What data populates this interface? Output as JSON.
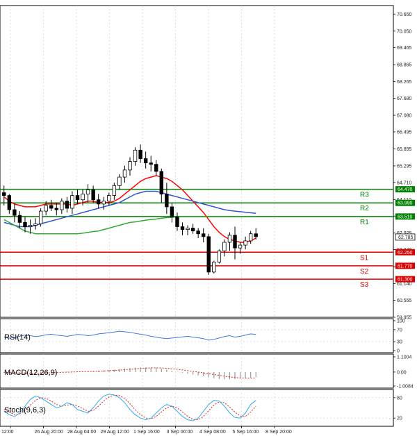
{
  "chart_data": {
    "type": "candlestick",
    "main": {
      "y_ticks": [
        "70.650",
        "70.050",
        "69.465",
        "68.865",
        "68.265",
        "67.680",
        "67.080",
        "66.495",
        "65.895",
        "65.295",
        "64.710",
        "64.110",
        "63.525",
        "62.925",
        "62.340",
        "61.740",
        "61.140",
        "60.555",
        "59.955"
      ],
      "ylim": [
        59.955,
        70.95
      ],
      "last_price": "62.785",
      "last_price_value": 62.785,
      "candles": [
        [
          64.35,
          64.6,
          63.9,
          64.25
        ],
        [
          64.25,
          64.3,
          63.6,
          63.75
        ],
        [
          63.75,
          63.95,
          63.3,
          63.55
        ],
        [
          63.55,
          63.7,
          63.1,
          63.3
        ],
        [
          63.3,
          63.5,
          62.95,
          63.15
        ],
        [
          63.15,
          63.4,
          62.9,
          63.2
        ],
        [
          63.2,
          63.45,
          63.05,
          63.25
        ],
        [
          63.25,
          63.8,
          63.15,
          63.7
        ],
        [
          63.7,
          64.05,
          63.55,
          63.9
        ],
        [
          63.9,
          64.1,
          63.7,
          63.8
        ],
        [
          63.8,
          64.0,
          63.55,
          63.75
        ],
        [
          63.75,
          64.15,
          63.6,
          64.05
        ],
        [
          64.05,
          64.2,
          63.65,
          63.8
        ],
        [
          63.8,
          64.4,
          63.6,
          64.25
        ],
        [
          64.25,
          64.45,
          63.95,
          64.1
        ],
        [
          64.1,
          64.45,
          63.9,
          64.3
        ],
        [
          64.3,
          64.65,
          64.0,
          64.45
        ],
        [
          64.45,
          64.6,
          64.0,
          64.1
        ],
        [
          64.1,
          64.3,
          63.8,
          63.95
        ],
        [
          63.95,
          64.2,
          63.75,
          64.05
        ],
        [
          64.05,
          64.35,
          63.9,
          64.25
        ],
        [
          64.25,
          64.7,
          64.1,
          64.6
        ],
        [
          64.6,
          65.0,
          64.45,
          64.9
        ],
        [
          64.9,
          65.3,
          64.7,
          65.15
        ],
        [
          65.15,
          65.6,
          64.95,
          65.45
        ],
        [
          65.45,
          65.95,
          65.3,
          65.85
        ],
        [
          65.85,
          66.05,
          65.4,
          65.55
        ],
        [
          65.55,
          65.8,
          65.2,
          65.4
        ],
        [
          65.4,
          65.65,
          65.1,
          65.35
        ],
        [
          65.35,
          65.5,
          64.95,
          65.1
        ],
        [
          65.1,
          65.2,
          64.0,
          64.3
        ],
        [
          64.3,
          64.7,
          63.6,
          63.85
        ],
        [
          63.85,
          64.0,
          63.3,
          63.5
        ],
        [
          63.5,
          63.65,
          63.0,
          63.15
        ],
        [
          63.15,
          63.3,
          62.85,
          63.05
        ],
        [
          63.05,
          63.2,
          62.85,
          63.1
        ],
        [
          63.1,
          63.25,
          62.9,
          63.0
        ],
        [
          63.0,
          63.1,
          62.75,
          62.9
        ],
        [
          62.9,
          63.1,
          62.6,
          62.8
        ],
        [
          62.8,
          62.9,
          61.45,
          61.55
        ],
        [
          61.55,
          61.95,
          61.5,
          61.9
        ],
        [
          61.9,
          62.35,
          61.85,
          62.3
        ],
        [
          62.3,
          62.7,
          62.1,
          62.6
        ],
        [
          62.6,
          62.95,
          62.3,
          62.85
        ],
        [
          62.85,
          63.15,
          62.0,
          62.4
        ],
        [
          62.4,
          62.6,
          62.2,
          62.5
        ],
        [
          62.5,
          62.8,
          62.35,
          62.65
        ],
        [
          62.65,
          63.0,
          62.55,
          62.9
        ],
        [
          62.9,
          63.1,
          62.7,
          62.8
        ]
      ],
      "overlays": [
        {
          "name": "ma_fast",
          "color": "#ff0000",
          "values": [
            64.2,
            64.05,
            63.95,
            63.9,
            63.85,
            63.85,
            63.85,
            63.9,
            63.95,
            63.95,
            63.95,
            63.95,
            63.95,
            63.9,
            63.95,
            64.0,
            64.05,
            64.05,
            64.0,
            64.0,
            64.0,
            64.05,
            64.15,
            64.3,
            64.45,
            64.6,
            64.75,
            64.85,
            64.9,
            64.95,
            64.9,
            64.85,
            64.75,
            64.6,
            64.45,
            64.25,
            64.05,
            63.85,
            63.65,
            63.4,
            63.15,
            62.95,
            62.8,
            62.7,
            62.65,
            62.6,
            62.6,
            62.65,
            62.75
          ]
        },
        {
          "name": "ma_mid",
          "color": "#3355cc",
          "values": [
            63.3,
            63.25,
            63.2,
            63.15,
            63.15,
            63.15,
            63.2,
            63.25,
            63.3,
            63.35,
            63.4,
            63.45,
            63.5,
            63.55,
            63.6,
            63.65,
            63.7,
            63.75,
            63.8,
            63.85,
            63.9,
            63.95,
            64.0,
            64.1,
            64.2,
            64.3,
            64.35,
            64.4,
            64.4,
            64.4,
            64.35,
            64.3,
            64.25,
            64.2,
            64.15,
            64.1,
            64.05,
            64.0,
            63.95,
            63.9,
            63.85,
            63.8,
            63.75,
            63.72,
            63.7,
            63.68,
            63.66,
            63.64,
            63.62
          ]
        },
        {
          "name": "ma_slow",
          "color": "#33aa33",
          "values": [
            63.4,
            63.3,
            63.2,
            63.1,
            63.0,
            62.95,
            62.9,
            62.9,
            62.9,
            62.9,
            62.9,
            62.9,
            62.9,
            62.9,
            62.9,
            62.92,
            62.95,
            62.98,
            63.0,
            63.05,
            63.1,
            63.15,
            63.2,
            63.25,
            63.3,
            63.32,
            63.35,
            63.38,
            63.4,
            63.42,
            63.45,
            63.47,
            63.48,
            63.5,
            63.5,
            63.5,
            63.5,
            63.5,
            63.5,
            63.5,
            63.5,
            63.5,
            63.5,
            63.5,
            63.5,
            63.5,
            63.5,
            63.5,
            63.5
          ]
        }
      ],
      "levels": [
        {
          "name": "R3",
          "value": 64.47,
          "tag": "64.470",
          "color": "#008000"
        },
        {
          "name": "R2",
          "value": 63.99,
          "tag": "63.990",
          "color": "#008000"
        },
        {
          "name": "R1",
          "value": 63.51,
          "tag": "63.510",
          "color": "#008000"
        },
        {
          "name": "S1",
          "value": 62.25,
          "tag": "62.250",
          "color": "#dd0000"
        },
        {
          "name": "S2",
          "value": 61.77,
          "tag": "61.770",
          "color": "#dd0000"
        },
        {
          "name": "S3",
          "value": 61.3,
          "tag": "61.300",
          "color": "#dd0000"
        }
      ]
    },
    "rsi": {
      "label": "RSI(14)",
      "y_ticks": [
        "100",
        "70",
        "30",
        "0"
      ],
      "ylim": [
        0,
        100
      ],
      "values": [
        45,
        42,
        44,
        48,
        52,
        50,
        47,
        49,
        53,
        55,
        52,
        50,
        48,
        51,
        54,
        53,
        50,
        52,
        56,
        58,
        60,
        62,
        65,
        63,
        61,
        58,
        55,
        52,
        48,
        45,
        42,
        40,
        42,
        44,
        46,
        48,
        45,
        43,
        40,
        35,
        38,
        42,
        47,
        50,
        45,
        48,
        52,
        56,
        54
      ],
      "color": "#4477dd"
    },
    "macd": {
      "label": "MACD(12,26,9)",
      "y_ticks": [
        "1.1004",
        "0.00",
        "-1.0084"
      ],
      "ylim": [
        -1.0084,
        1.1004
      ],
      "histogram": [
        -0.05,
        -0.08,
        -0.1,
        -0.12,
        -0.12,
        -0.1,
        -0.08,
        -0.06,
        -0.04,
        -0.02,
        0.0,
        0.02,
        0.03,
        0.04,
        0.05,
        0.06,
        0.07,
        0.08,
        0.1,
        0.12,
        0.15,
        0.18,
        0.22,
        0.26,
        0.3,
        0.32,
        0.33,
        0.33,
        0.32,
        0.3,
        0.25,
        0.18,
        0.1,
        0.02,
        -0.05,
        -0.12,
        -0.18,
        -0.24,
        -0.3,
        -0.38,
        -0.45,
        -0.5,
        -0.52,
        -0.52,
        -0.5,
        -0.47,
        -0.44,
        -0.4,
        -0.36
      ],
      "signal": [
        -0.02,
        -0.04,
        -0.06,
        -0.07,
        -0.08,
        -0.08,
        -0.08,
        -0.07,
        -0.06,
        -0.05,
        -0.04,
        -0.02,
        -0.01,
        0.0,
        0.02,
        0.03,
        0.04,
        0.05,
        0.06,
        0.08,
        0.1,
        0.12,
        0.14,
        0.17,
        0.2,
        0.23,
        0.26,
        0.28,
        0.3,
        0.3,
        0.29,
        0.27,
        0.24,
        0.2,
        0.15,
        0.1,
        0.05,
        0.0,
        -0.06,
        -0.12,
        -0.18,
        -0.24,
        -0.3,
        -0.35,
        -0.39,
        -0.42,
        -0.43,
        -0.43,
        -0.42
      ]
    },
    "stoch": {
      "label": "Stoch(9,6,3)",
      "y_ticks": [
        "80",
        "20"
      ],
      "ylim": [
        0,
        100
      ],
      "main_line": [
        40,
        30,
        25,
        35,
        55,
        75,
        85,
        80,
        70,
        60,
        50,
        55,
        65,
        60,
        45,
        40,
        35,
        50,
        70,
        85,
        90,
        88,
        80,
        65,
        45,
        30,
        20,
        15,
        20,
        35,
        50,
        60,
        55,
        40,
        25,
        15,
        12,
        20,
        40,
        60,
        72,
        70,
        55,
        35,
        22,
        20,
        35,
        60,
        72
      ],
      "signal_line": [
        45,
        38,
        30,
        32,
        42,
        58,
        72,
        80,
        78,
        70,
        60,
        55,
        58,
        60,
        55,
        48,
        40,
        42,
        55,
        70,
        82,
        88,
        86,
        78,
        62,
        45,
        30,
        20,
        18,
        25,
        38,
        50,
        55,
        50,
        38,
        25,
        16,
        15,
        25,
        42,
        58,
        68,
        65,
        52,
        38,
        26,
        25,
        38,
        55
      ],
      "main_color": "#33aaee",
      "signal_color": "#dd2222"
    },
    "x_ticks": [
      "12:00",
      "26 Aug 20:00",
      "28 Aug 04:00",
      "29 Aug 12:00",
      "1 Sep 16:00",
      "3 Sep 00:00",
      "4 Sep 08:00",
      "5 Sep 16:00",
      "8 Sep 20:00"
    ]
  }
}
